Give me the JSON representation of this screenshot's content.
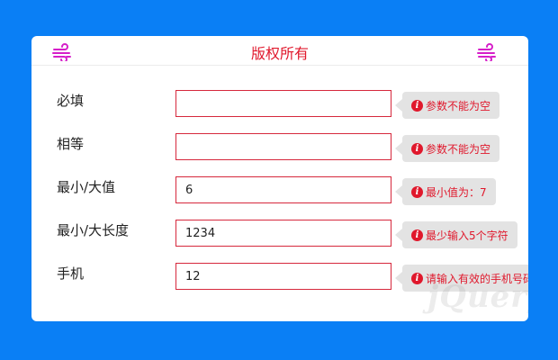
{
  "header": {
    "title": "版权所有",
    "left_icon": "wind-icon",
    "right_icon": "wind-icon",
    "accent_color": "#e0182c"
  },
  "form": {
    "rows": [
      {
        "label": "必填",
        "value": "",
        "tip": "参数不能为空"
      },
      {
        "label": "相等",
        "value": "",
        "tip": "参数不能为空"
      },
      {
        "label": "最小/大值",
        "value": "6",
        "tip": "最小值为：7"
      },
      {
        "label": "最小/大长度",
        "value": "1234",
        "tip": "最少输入5个字符"
      },
      {
        "label": "手机",
        "value": "12",
        "tip": "请输入有效的手机号码"
      }
    ]
  },
  "tip_icon": "exclamation-icon",
  "watermark": "jQuery",
  "colors": {
    "background": "#0a7ff5",
    "error": "#e0182c",
    "tip_bg": "#e3e3e3"
  }
}
